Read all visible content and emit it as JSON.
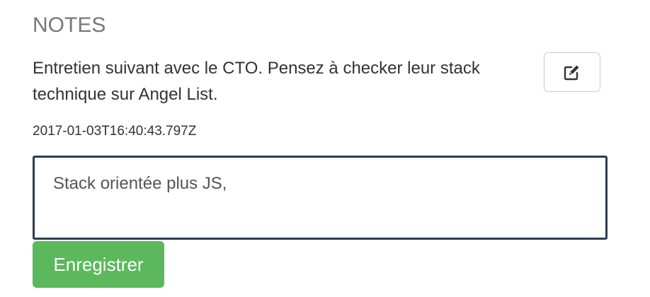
{
  "notes": {
    "title": "NOTES",
    "note_text": "Entretien suivant avec le CTO. Pensez à checker leur stack technique sur Angel List.",
    "timestamp": "2017-01-03T16:40:43.797Z",
    "edit_icon": "pencil-square-icon"
  },
  "editor": {
    "input_value": "Stack orientée plus JS, ",
    "save_label": "Enregistrer",
    "save_color": "#5cb85c",
    "input_border_color": "#2f3d4c"
  }
}
